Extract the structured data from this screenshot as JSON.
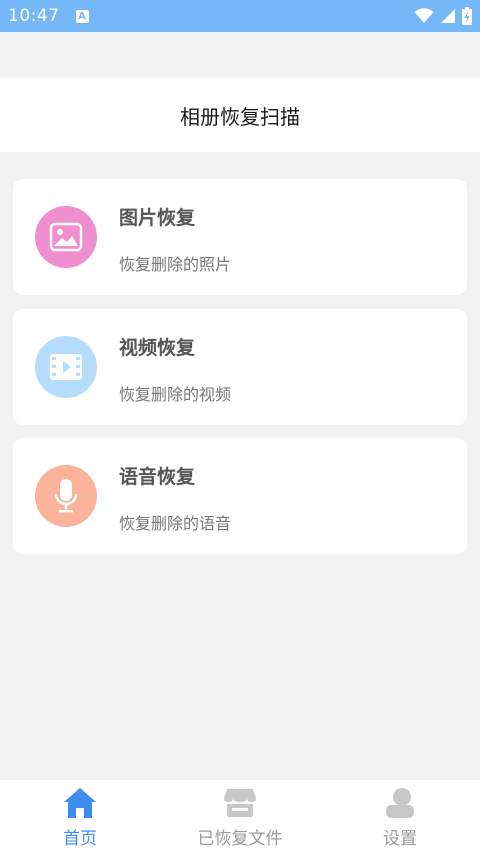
{
  "status_bar": {
    "time": "10:47",
    "notification_letter": "A"
  },
  "header": {
    "title": "相册恢复扫描"
  },
  "cards": [
    {
      "title": "图片恢复",
      "subtitle": "恢复删除的照片",
      "icon": "image-icon",
      "icon_bg": "#ef8fcf"
    },
    {
      "title": "视频恢复",
      "subtitle": "恢复删除的视频",
      "icon": "video-icon",
      "icon_bg": "#b6dcfb"
    },
    {
      "title": "语音恢复",
      "subtitle": "恢复删除的语音",
      "icon": "microphone-icon",
      "icon_bg": "#fbb39b"
    }
  ],
  "tabs": [
    {
      "label": "首页",
      "icon": "home-icon",
      "active": true
    },
    {
      "label": "已恢复文件",
      "icon": "store-icon",
      "active": false
    },
    {
      "label": "设置",
      "icon": "user-icon",
      "active": false
    }
  ],
  "colors": {
    "status_bar": "#75b7f7",
    "accent": "#3d8cf0",
    "inactive": "#9a9a9a"
  }
}
